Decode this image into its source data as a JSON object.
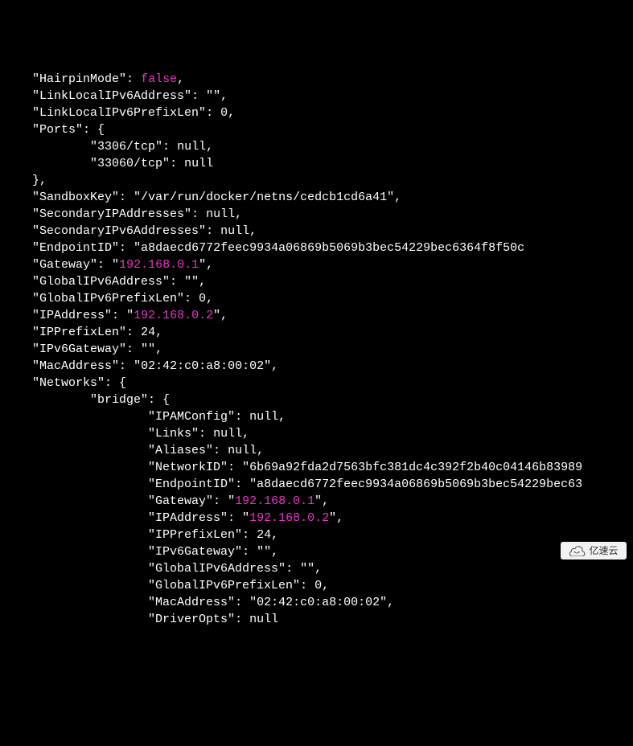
{
  "lines": [
    {
      "i": 2,
      "k": "HairpinMode",
      "type": "bool",
      "v": "false",
      "comma": true
    },
    {
      "i": 2,
      "k": "LinkLocalIPv6Address",
      "type": "str",
      "v": "",
      "comma": true
    },
    {
      "i": 2,
      "k": "LinkLocalIPv6PrefixLen",
      "type": "num",
      "v": "0",
      "comma": true
    },
    {
      "i": 2,
      "k": "Ports",
      "type": "open",
      "v": "{"
    },
    {
      "i": 4,
      "k": "3306/tcp",
      "type": "null",
      "v": "null",
      "comma": true
    },
    {
      "i": 4,
      "k": "33060/tcp",
      "type": "null",
      "v": "null"
    },
    {
      "i": 2,
      "k": null,
      "type": "close",
      "v": "},"
    },
    {
      "i": 2,
      "k": "SandboxKey",
      "type": "str",
      "v": "/var/run/docker/netns/cedcb1cd6a41",
      "comma": true
    },
    {
      "i": 2,
      "k": "SecondaryIPAddresses",
      "type": "null",
      "v": "null",
      "comma": true
    },
    {
      "i": 2,
      "k": "SecondaryIPv6Addresses",
      "type": "null",
      "v": "null",
      "comma": true
    },
    {
      "i": 2,
      "k": "EndpointID",
      "type": "str",
      "v": "a8daecd6772feec9934a06869b5069b3bec54229bec6364f8f50c",
      "comma": false,
      "noclose": true
    },
    {
      "i": 2,
      "k": "Gateway",
      "type": "strip",
      "v": "192.168.0.1",
      "comma": true
    },
    {
      "i": 2,
      "k": "GlobalIPv6Address",
      "type": "str",
      "v": "",
      "comma": true
    },
    {
      "i": 2,
      "k": "GlobalIPv6PrefixLen",
      "type": "num",
      "v": "0",
      "comma": true
    },
    {
      "i": 2,
      "k": "IPAddress",
      "type": "strip",
      "v": "192.168.0.2",
      "comma": true
    },
    {
      "i": 2,
      "k": "IPPrefixLen",
      "type": "num",
      "v": "24",
      "comma": true
    },
    {
      "i": 2,
      "k": "IPv6Gateway",
      "type": "str",
      "v": "",
      "comma": true
    },
    {
      "i": 2,
      "k": "MacAddress",
      "type": "str",
      "v": "02:42:c0:a8:00:02",
      "comma": true
    },
    {
      "i": 2,
      "k": "Networks",
      "type": "open",
      "v": "{"
    },
    {
      "i": 4,
      "k": "bridge",
      "type": "open",
      "v": "{"
    },
    {
      "i": 6,
      "k": "IPAMConfig",
      "type": "null",
      "v": "null",
      "comma": true
    },
    {
      "i": 6,
      "k": "Links",
      "type": "null",
      "v": "null",
      "comma": true
    },
    {
      "i": 6,
      "k": "Aliases",
      "type": "null",
      "v": "null",
      "comma": true
    },
    {
      "i": 6,
      "k": "NetworkID",
      "type": "str",
      "v": "6b69a92fda2d7563bfc381dc4c392f2b40c04146b83989",
      "comma": false,
      "noclose": true
    },
    {
      "i": 6,
      "k": "EndpointID",
      "type": "str",
      "v": "a8daecd6772feec9934a06869b5069b3bec54229bec63",
      "comma": false,
      "noclose": true
    },
    {
      "i": 6,
      "k": "Gateway",
      "type": "strip",
      "v": "192.168.0.1",
      "comma": true
    },
    {
      "i": 6,
      "k": "IPAddress",
      "type": "strip",
      "v": "192.168.0.2",
      "comma": true
    },
    {
      "i": 6,
      "k": "IPPrefixLen",
      "type": "num",
      "v": "24",
      "comma": true
    },
    {
      "i": 6,
      "k": "IPv6Gateway",
      "type": "str",
      "v": "",
      "comma": true
    },
    {
      "i": 6,
      "k": "GlobalIPv6Address",
      "type": "str",
      "v": "",
      "comma": true
    },
    {
      "i": 6,
      "k": "GlobalIPv6PrefixLen",
      "type": "num",
      "v": "0",
      "comma": true
    },
    {
      "i": 6,
      "k": "MacAddress",
      "type": "str",
      "v": "02:42:c0:a8:00:02",
      "comma": true
    },
    {
      "i": 6,
      "k": "DriverOpts",
      "type": "null",
      "v": "null"
    }
  ],
  "watermark": {
    "text": "亿速云"
  }
}
